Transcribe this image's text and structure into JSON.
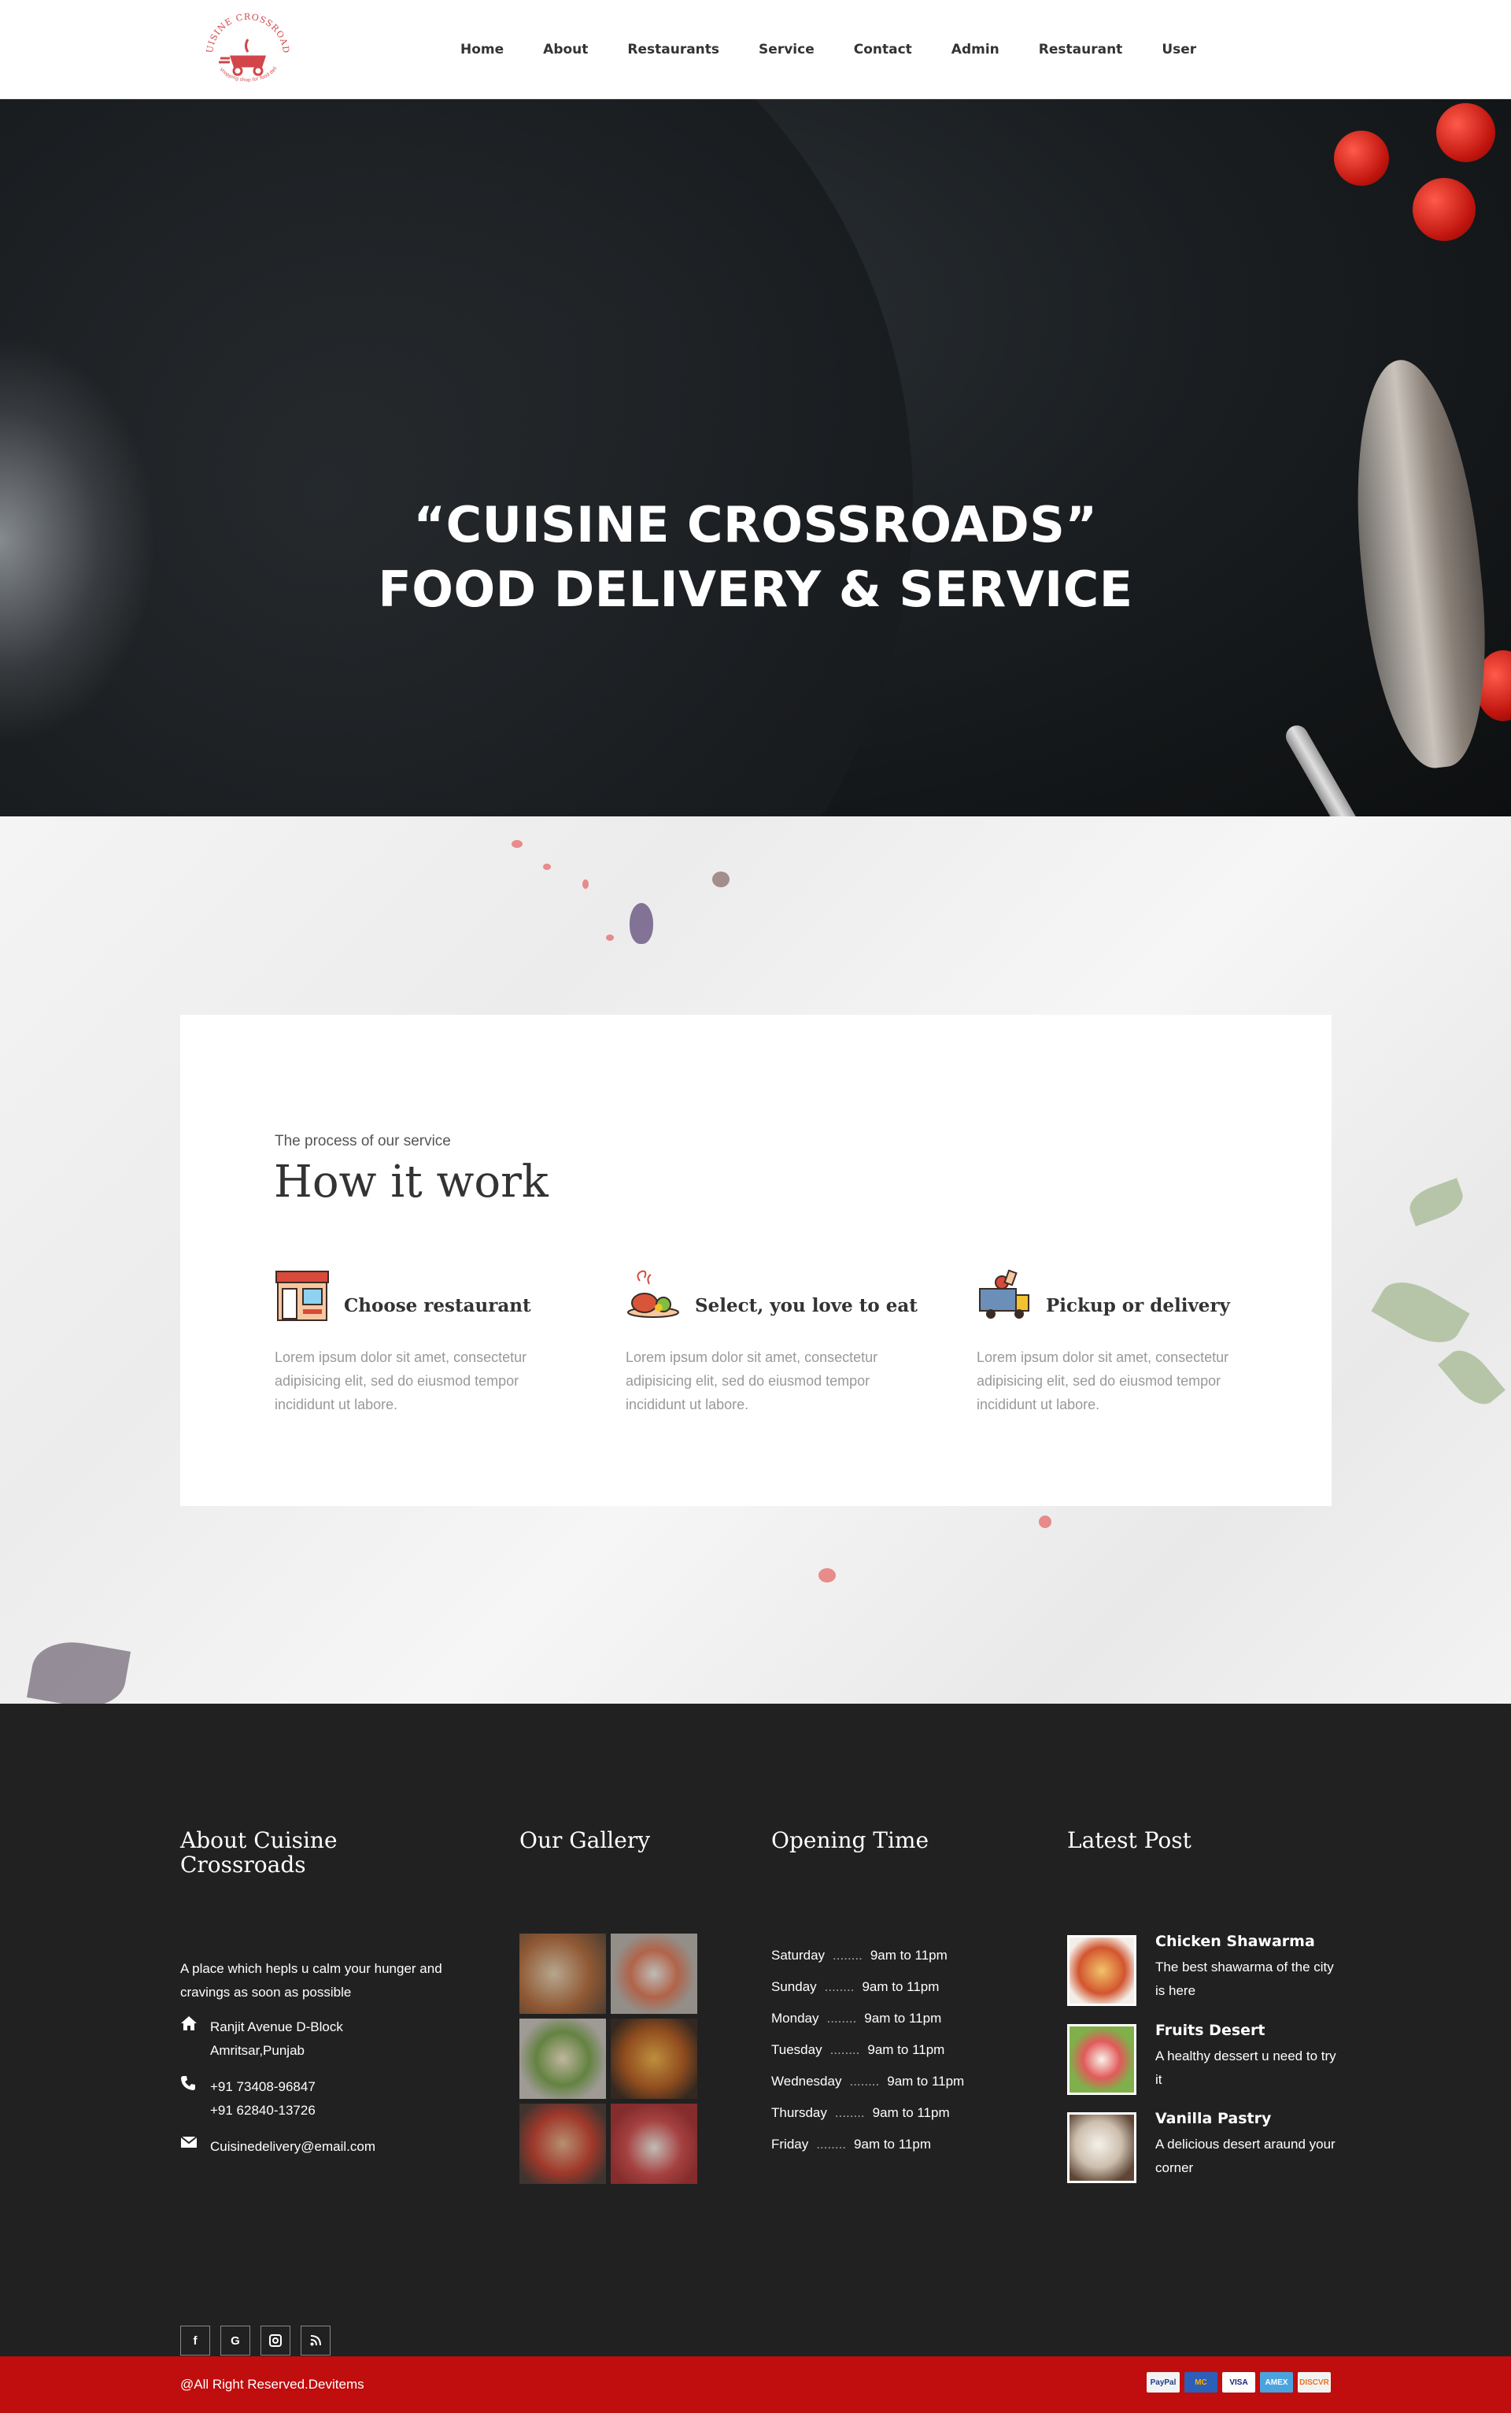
{
  "brand": {
    "name": "Cuisine Crossroads",
    "logo_tagline": "Best shopping shop for food delivery",
    "accent": "#c00d0d"
  },
  "nav": {
    "items": [
      {
        "label": "Home"
      },
      {
        "label": "About"
      },
      {
        "label": "Restaurants"
      },
      {
        "label": "Service"
      },
      {
        "label": "Contact"
      },
      {
        "label": "Admin"
      },
      {
        "label": "Restaurant"
      },
      {
        "label": "User"
      }
    ]
  },
  "hero": {
    "line1": "“CUISINE CROSSROADS”",
    "line2": "FOOD DELIVERY & SERVICE"
  },
  "how": {
    "eyebrow": "The process of our service",
    "title": "How it work",
    "steps": [
      {
        "icon": "restaurant-icon",
        "title": "Choose restaurant",
        "text": "Lorem ipsum dolor sit amet, consectetur adipisicing elit, sed do eiusmod tempor incididunt ut labore."
      },
      {
        "icon": "food-plate-icon",
        "title": "Select, you love to eat",
        "text": "Lorem ipsum dolor sit amet, consectetur adipisicing elit, sed do eiusmod tempor incididunt ut labore."
      },
      {
        "icon": "delivery-truck-icon",
        "title": "Pickup or delivery",
        "text": "Lorem ipsum dolor sit amet, consectetur adipisicing elit, sed do eiusmod tempor incididunt ut labore."
      }
    ]
  },
  "footer": {
    "about": {
      "title_line1": "About Cuisine",
      "title_line2": "Crossroads",
      "description": "A place which hepls u calm your hunger and cravings as soon as possible",
      "address_line1": "Ranjit Avenue D-Block",
      "address_line2": "Amritsar,Punjab",
      "phone1": "+91 73408-96847",
      "phone2": "+91 62840-13726",
      "email": "Cuisinedelivery@email.com",
      "socials": [
        {
          "icon": "facebook-icon",
          "glyph": "f"
        },
        {
          "icon": "google-icon",
          "glyph": "G"
        },
        {
          "icon": "instagram-icon",
          "glyph": "◙"
        },
        {
          "icon": "rss-icon",
          "glyph": ")"
        }
      ]
    },
    "gallery": {
      "title": "Our Gallery"
    },
    "hours": {
      "title": "Opening Time",
      "rows": [
        {
          "day": "Saturday",
          "dots": "........",
          "time": "9am to 11pm"
        },
        {
          "day": "Sunday",
          "dots": "........",
          "time": "9am to 11pm"
        },
        {
          "day": "Monday",
          "dots": "........",
          "time": "9am to 11pm"
        },
        {
          "day": "Tuesday",
          "dots": "........",
          "time": "9am to 11pm"
        },
        {
          "day": "Wednesday",
          "dots": "........",
          "time": "9am to 11pm"
        },
        {
          "day": "Thursday",
          "dots": "........",
          "time": "9am to 11pm"
        },
        {
          "day": "Friday",
          "dots": "........",
          "time": "9am to 11pm"
        }
      ]
    },
    "posts": {
      "title": "Latest Post",
      "items": [
        {
          "title": "Chicken Shawarma",
          "text": "The best shawarma of the city is here"
        },
        {
          "title": "Fruits Desert",
          "text": "A healthy dessert u need to try it"
        },
        {
          "title": "Vanilla Pastry",
          "text": "A delicious desert araund your corner"
        }
      ]
    }
  },
  "bottom": {
    "copyright": "@All Right Reserved.Devitems",
    "payments": [
      {
        "label": "PayPal",
        "bg": "#f3f3f3",
        "fg": "#1f3b8a"
      },
      {
        "label": "MC",
        "bg": "#2b5fb8",
        "fg": "#ffb000"
      },
      {
        "label": "VISA",
        "bg": "#ffffff",
        "fg": "#1a1f71"
      },
      {
        "label": "AMEX",
        "bg": "#4aa3df",
        "fg": "#ffffff"
      },
      {
        "label": "DISCVR",
        "bg": "#f3f3f3",
        "fg": "#e87422"
      }
    ]
  }
}
